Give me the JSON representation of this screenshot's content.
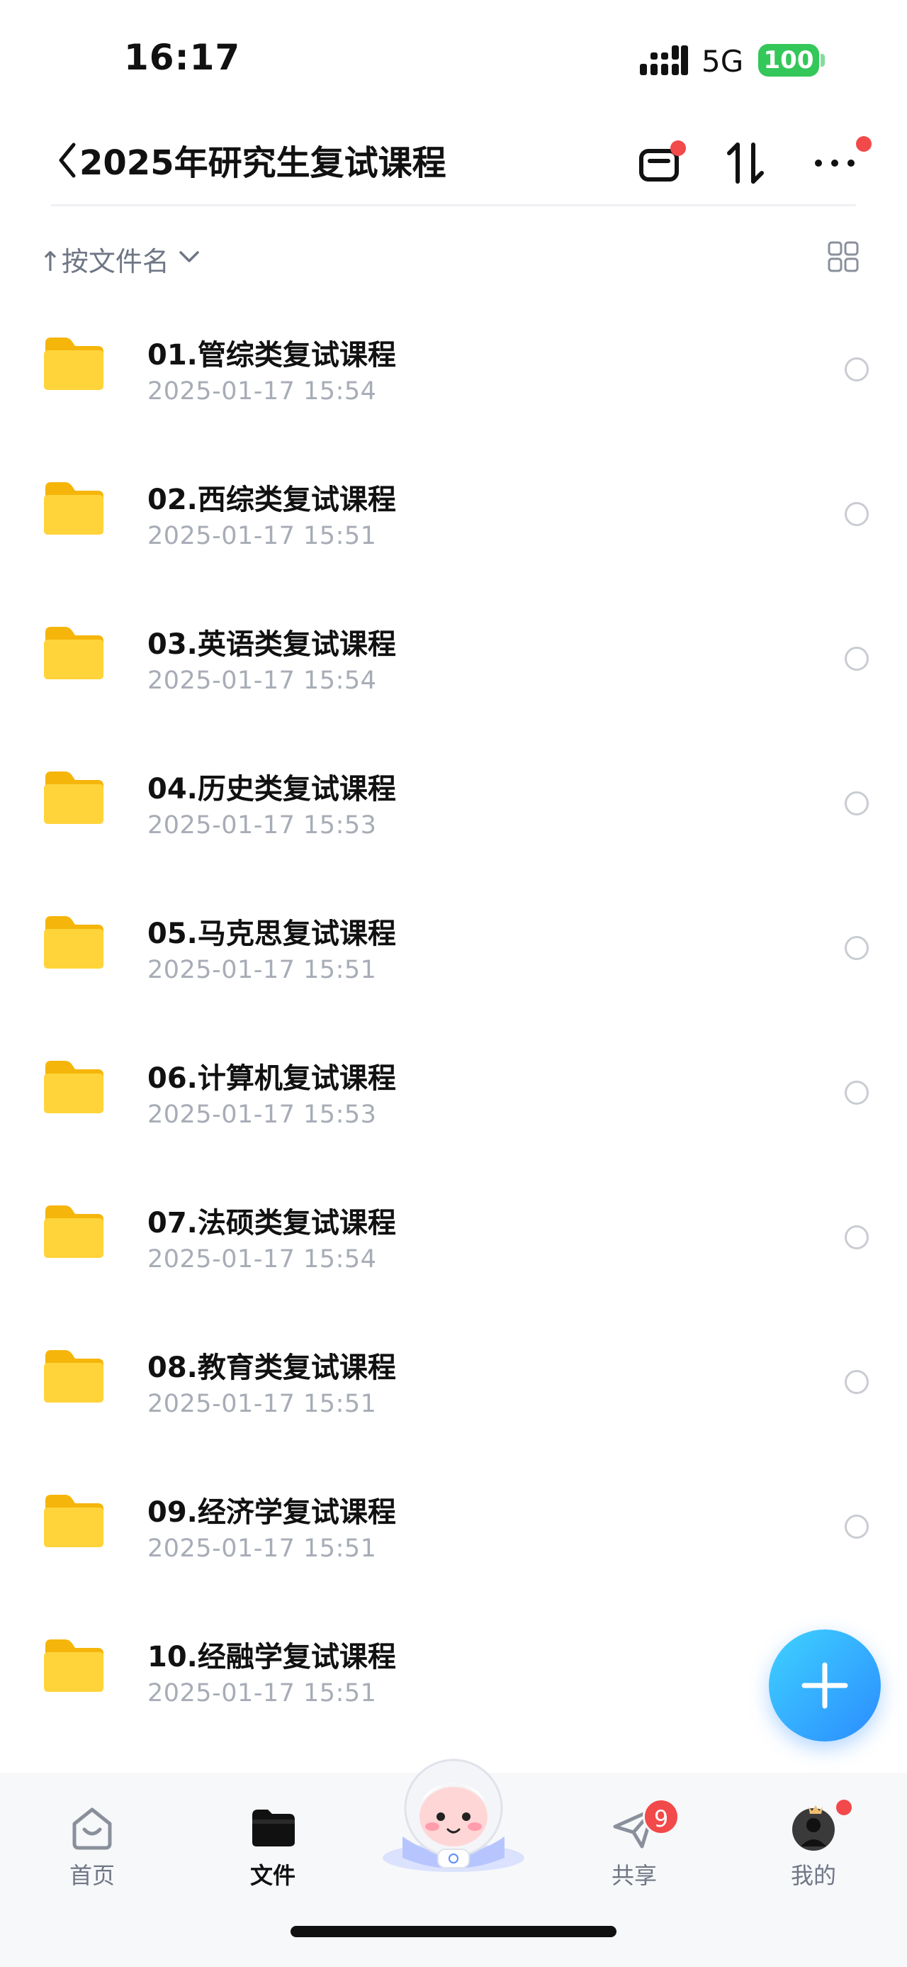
{
  "status_bar": {
    "time": "16:17",
    "network": "5G",
    "battery": "100"
  },
  "header": {
    "title": "2025年研究生复试课程"
  },
  "sort_bar": {
    "label": "↑按文件名"
  },
  "files": [
    {
      "name": "01.管综类复试课程",
      "date": "2025-01-17 15:54"
    },
    {
      "name": "02.西综类复试课程",
      "date": "2025-01-17 15:51"
    },
    {
      "name": "03.英语类复试课程",
      "date": "2025-01-17 15:54"
    },
    {
      "name": "04.历史类复试课程",
      "date": "2025-01-17 15:53"
    },
    {
      "name": "05.马克思复试课程",
      "date": "2025-01-17 15:51"
    },
    {
      "name": "06.计算机复试课程",
      "date": "2025-01-17 15:53"
    },
    {
      "name": "07.法硕类复试课程",
      "date": "2025-01-17 15:54"
    },
    {
      "name": "08.教育类复试课程",
      "date": "2025-01-17 15:51"
    },
    {
      "name": "09.经济学复试课程",
      "date": "2025-01-17 15:51"
    },
    {
      "name": "10.经融学复试课程",
      "date": "2025-01-17 15:51"
    }
  ],
  "nav": {
    "home": "首页",
    "files": "文件",
    "share": "共享",
    "share_badge": "9",
    "mine": "我的"
  },
  "colors": {
    "accent": "#2b8cff",
    "folder": "#fcc419",
    "badge": "#f2494a",
    "battery": "#34c759"
  }
}
